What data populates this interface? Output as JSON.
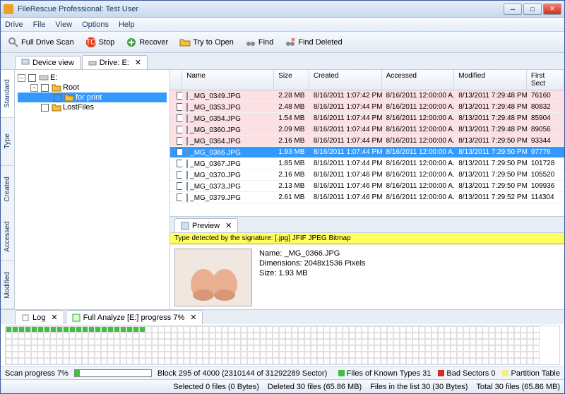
{
  "title": "FileRescue Professional: Test User",
  "menu": [
    "Drive",
    "File",
    "View",
    "Options",
    "Help"
  ],
  "toolbar": {
    "scan": "Full Drive Scan",
    "stop": "Stop",
    "recover": "Recover",
    "tryopen": "Try to Open",
    "find": "Find",
    "finddel": "Find Deleted"
  },
  "tabs": {
    "device": "Device view",
    "drive": "Drive: E:"
  },
  "vtabs": [
    "Standard",
    "Type",
    "Created",
    "Accessed",
    "Modified"
  ],
  "tree": {
    "root": "E:",
    "n1": "Root",
    "n2": "for print",
    "n3": "LostFiles"
  },
  "columns": {
    "name": "Name",
    "size": "Size",
    "created": "Created",
    "accessed": "Accessed",
    "modified": "Modified",
    "sect": "First Sect"
  },
  "files": [
    {
      "name": "_MG_0349.JPG",
      "size": "2.28 MB",
      "created": "8/16/2011 1:07:42 PM",
      "accessed": "8/16/2011 12:00:00 A..",
      "modified": "8/13/2011 7:29:48 PM",
      "sect": "76160",
      "pink": true
    },
    {
      "name": "_MG_0353.JPG",
      "size": "2.48 MB",
      "created": "8/16/2011 1:07:44 PM",
      "accessed": "8/16/2011 12:00:00 A..",
      "modified": "8/13/2011 7:29:48 PM",
      "sect": "80832",
      "pink": true
    },
    {
      "name": "_MG_0354.JPG",
      "size": "1.54 MB",
      "created": "8/16/2011 1:07:44 PM",
      "accessed": "8/16/2011 12:00:00 A..",
      "modified": "8/13/2011 7:29:48 PM",
      "sect": "85904",
      "pink": true
    },
    {
      "name": "_MG_0360.JPG",
      "size": "2.09 MB",
      "created": "8/16/2011 1:07:44 PM",
      "accessed": "8/16/2011 12:00:00 A..",
      "modified": "8/13/2011 7:29:48 PM",
      "sect": "89056",
      "pink": true
    },
    {
      "name": "_MG_0364.JPG",
      "size": "2.16 MB",
      "created": "8/16/2011 1:07:44 PM",
      "accessed": "8/16/2011 12:00:00 A..",
      "modified": "8/13/2011 7:29:50 PM",
      "sect": "93344",
      "pink": true
    },
    {
      "name": "_MG_0366.JPG",
      "size": "1.93 MB",
      "created": "8/16/2011 1:07:44 PM",
      "accessed": "8/16/2011 12:00:00 A..",
      "modified": "8/13/2011 7:29:50 PM",
      "sect": "97776",
      "sel": true
    },
    {
      "name": "_MG_0367.JPG",
      "size": "1.85 MB",
      "created": "8/16/2011 1:07:44 PM",
      "accessed": "8/16/2011 12:00:00 A..",
      "modified": "8/13/2011 7:29:50 PM",
      "sect": "101728"
    },
    {
      "name": "_MG_0370.JPG",
      "size": "2.16 MB",
      "created": "8/16/2011 1:07:46 PM",
      "accessed": "8/16/2011 12:00:00 A..",
      "modified": "8/13/2011 7:29:50 PM",
      "sect": "105520"
    },
    {
      "name": "_MG_0373.JPG",
      "size": "2.13 MB",
      "created": "8/16/2011 1:07:46 PM",
      "accessed": "8/16/2011 12:00:00 A..",
      "modified": "8/13/2011 7:29:50 PM",
      "sect": "109936"
    },
    {
      "name": "_MG_0379.JPG",
      "size": "2.61 MB",
      "created": "8/16/2011 1:07:46 PM",
      "accessed": "8/16/2011 12:00:00 A..",
      "modified": "8/13/2011 7:29:52 PM",
      "sect": "114304"
    }
  ],
  "preview": {
    "tab": "Preview",
    "sig": "Type detected by the signature: [.jpg] JFIF JPEG Bitmap",
    "name_lbl": "Name:",
    "name": "_MG_0366.JPG",
    "dim_lbl": "Dimensions:",
    "dim": "2048x1536 Pixels",
    "size_lbl": "Size:",
    "size": "1.93 MB"
  },
  "bottom": {
    "log": "Log",
    "analyze": "Full Analyze [E:] progress 7%",
    "scanprog": "Scan progress 7%",
    "block": "Block 295 of 4000 (2310144 of 31292289 Sector)",
    "leg1": "Files of Known Types 31",
    "leg2": "Bad Sectors 0",
    "leg3": "Partition Table"
  },
  "status": {
    "sel": "Selected 0 files (0 Bytes)",
    "del": "Deleted 30 files (65.86 MB)",
    "inlist": "Files in the list 30 (30 Bytes)",
    "total": "Total 30 files (65.86 MB)"
  }
}
